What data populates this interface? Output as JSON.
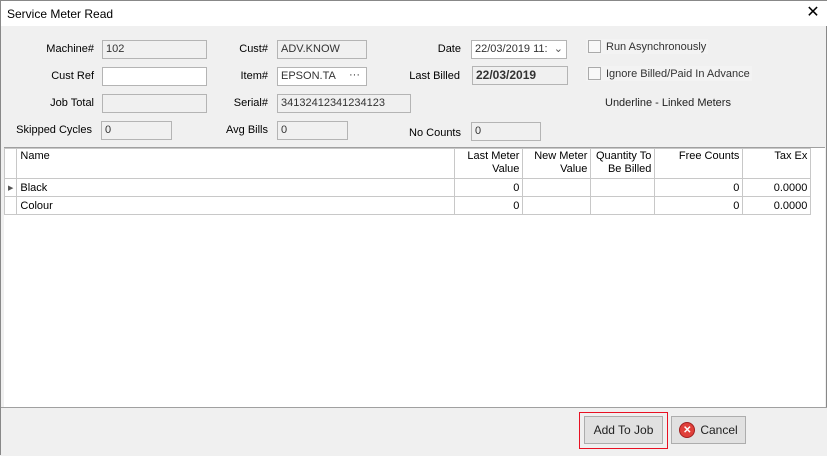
{
  "window": {
    "title": "Service Meter Read",
    "close": "✕"
  },
  "form": {
    "machine_label": "Machine#",
    "machine": "102",
    "custref_label": "Cust Ref",
    "custref": "",
    "jobtotal_label": "Job Total",
    "jobtotal": "",
    "skipped_label": "Skipped Cycles",
    "skipped": "0",
    "cust_label": "Cust#",
    "cust": "ADV.KNOW",
    "item_label": "Item#",
    "item": "EPSON.TA",
    "item_browse": "···",
    "serial_label": "Serial#",
    "serial": "34132412341234123",
    "avgbills_label": "Avg Bills",
    "avgbills": "0",
    "date_label": "Date",
    "date": "22/03/2019 11:",
    "lastbilled_label": "Last Billed",
    "lastbilled": "22/03/2019",
    "nocounts_label": "No Counts",
    "nocounts": "0",
    "run_async": {
      "label": "Run Asynchronously",
      "checked": false
    },
    "ignore_billed": {
      "label": "Ignore Billed/Paid In Advance",
      "checked": false
    },
    "legend": "Underline - Linked Meters"
  },
  "grid": {
    "columns": [
      "Name",
      "Last Meter Value",
      "New Meter Value",
      "Quantity To Be Billed",
      "Free Counts",
      "Tax Ex"
    ],
    "rows": [
      {
        "name": "Black",
        "last": "0",
        "new": "",
        "qty": "",
        "free": "0",
        "tax": "0.0000"
      },
      {
        "name": "Colour",
        "last": "0",
        "new": "",
        "qty": "",
        "free": "0",
        "tax": "0.0000"
      }
    ]
  },
  "buttons": {
    "add": "Add To Job",
    "cancel": "Cancel"
  }
}
